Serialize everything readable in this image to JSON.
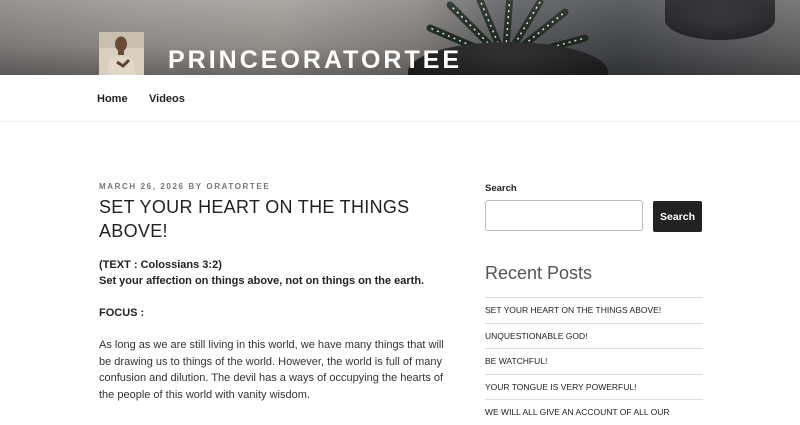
{
  "header": {
    "site_title": "PRINCEORATORTEE"
  },
  "nav": {
    "items": [
      {
        "label": "Home"
      },
      {
        "label": "Videos"
      }
    ]
  },
  "post": {
    "date": "MARCH 26, 2026",
    "by": "BY",
    "author": "ORATORTEE",
    "title": "SET YOUR HEART ON THE THINGS ABOVE!",
    "text_ref": "(TEXT : Colossians 3:2)",
    "text_verse": "Set your affection on things above, not on things on the earth.",
    "focus_label": "FOCUS :",
    "paragraph": "As long as we are still living in this world, we have many things that will be drawing us to things of the world. However, the world is full of many confusion and dilution. The devil has a ways of occupying the hearts of the people of this world with vanity wisdom."
  },
  "sidebar": {
    "search": {
      "label": "Search",
      "button_label": "Search",
      "value": "",
      "placeholder": ""
    },
    "recent_posts": {
      "title": "Recent Posts",
      "items": [
        "SET YOUR HEART ON THE THINGS ABOVE!",
        "UNQUESTIONABLE GOD!",
        "BE WATCHFUL!",
        "YOUR TONGUE IS VERY POWERFUL!",
        "WE WILL ALL GIVE AN ACCOUNT OF ALL OUR"
      ]
    }
  }
}
